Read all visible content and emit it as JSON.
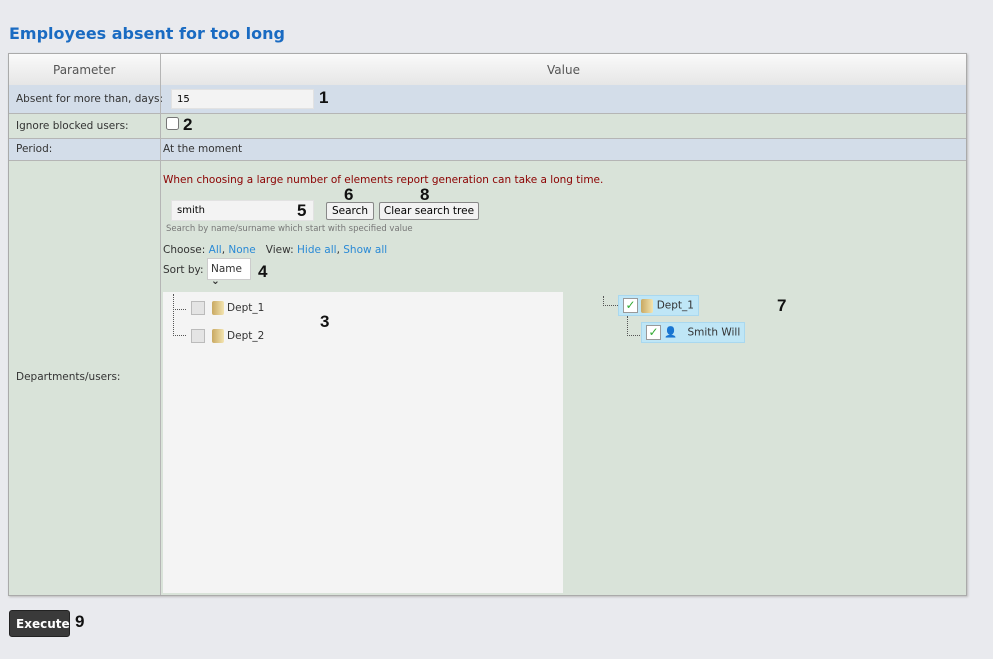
{
  "title": "Employees absent for too long",
  "header": {
    "parameter": "Parameter",
    "value": "Value"
  },
  "rows": {
    "absent": {
      "label": "Absent for more than, days:",
      "value": "15"
    },
    "ignore": {
      "label": "Ignore blocked users:"
    },
    "period": {
      "label": "Period:",
      "value": "At the moment"
    },
    "depts": {
      "label": "Departments/users:"
    }
  },
  "warning": "When choosing a large number of elements report generation can take a long time.",
  "search": {
    "value": "smith",
    "hint": "Search by name/surname which start with specified value",
    "search_label": "Search",
    "clear_label": "Clear search tree"
  },
  "choose": {
    "label": "Choose:",
    "all": "All",
    "none": "None",
    "view_label": "View:",
    "hide_all": "Hide all",
    "show_all": "Show all"
  },
  "sort": {
    "label": "Sort by:",
    "selected": "Name"
  },
  "left_tree": [
    "Dept_1",
    "Dept_2"
  ],
  "right_tree": {
    "dept": "Dept_1",
    "user": "Smith Will"
  },
  "execute_label": "Execute",
  "callouts": [
    "1",
    "2",
    "3",
    "4",
    "5",
    "6",
    "7",
    "8",
    "9"
  ]
}
